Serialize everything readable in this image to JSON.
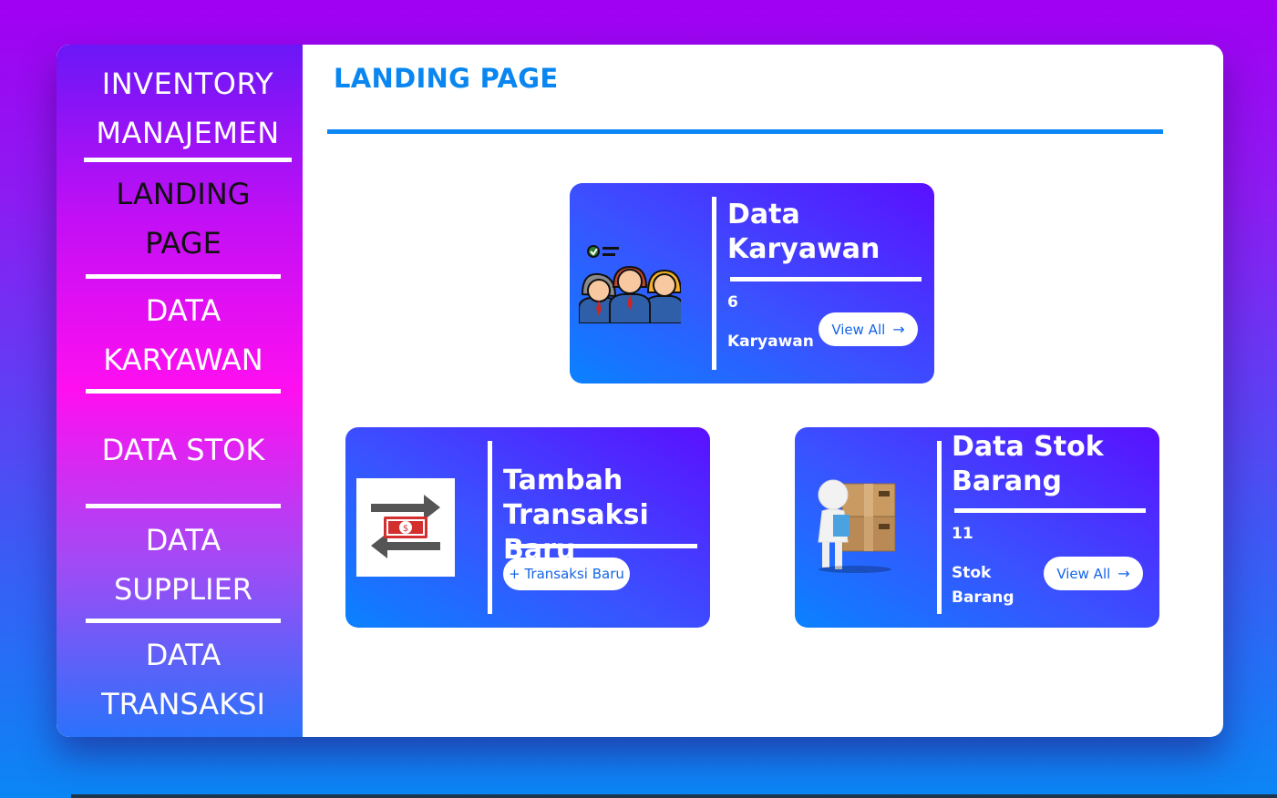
{
  "sidebar": {
    "brand_line1": "INVENTORY",
    "brand_line2": "MANAJEMEN",
    "items": [
      {
        "line1": "LANDING",
        "line2": "PAGE"
      },
      {
        "line1": "DATA",
        "line2": "KARYAWAN"
      },
      {
        "line1": "DATA STOK",
        "line2": ""
      },
      {
        "line1": "DATA",
        "line2": "SUPPLIER"
      },
      {
        "line1": "DATA",
        "line2": "TRANSAKSI"
      }
    ]
  },
  "main": {
    "title": "LANDING PAGE",
    "cards": {
      "karyawan": {
        "title_line1": "Data",
        "title_line2": "Karyawan",
        "count": "6",
        "unit": "Karyawan",
        "button": "View All",
        "icon": "employees-group-icon"
      },
      "transaksi": {
        "title_line1": "Tambah",
        "title_line2": "Transaksi Baru",
        "button": "+ Transaksi Baru",
        "icon": "money-exchange-icon"
      },
      "stok": {
        "title_line1": "Data Stok",
        "title_line2": "Barang",
        "count": "11",
        "unit_line1": "Stok",
        "unit_line2": "Barang",
        "button": "View All",
        "icon": "person-with-boxes-icon"
      }
    }
  },
  "colors": {
    "accent": "#0a86f5",
    "active_nav_text": "#111111",
    "card_gradient_start": "#0a82ff",
    "card_gradient_end": "#5a10ff"
  }
}
